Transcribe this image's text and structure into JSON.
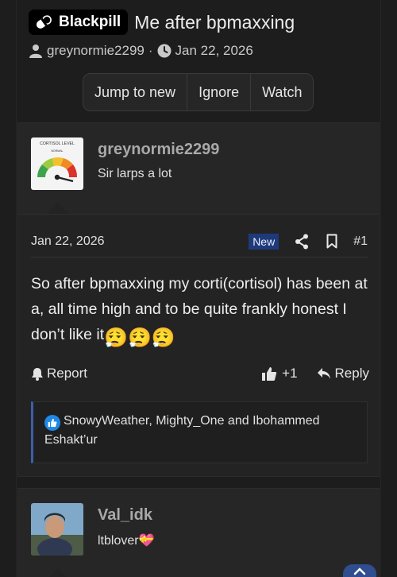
{
  "thread": {
    "prefix": "Blackpill",
    "title": "Me after bpmaxxing",
    "author": "greynormie2299",
    "separator": "·",
    "date": "Jan 22, 2026"
  },
  "thread_actions": {
    "jump_label": "Jump to new",
    "ignore_label": "Ignore",
    "watch_label": "Watch"
  },
  "avatar1": {
    "caption": "CORTISOL LEVEL",
    "gauge_label": "NORMAL"
  },
  "post": {
    "username": "greynormie2299",
    "user_title": "Sir larps a lot",
    "date": "Jan 22, 2026",
    "new_badge": "New",
    "number": "#1",
    "body": "So after bpmaxxing my corti(cortisol) has been at a, all time high and to be quite frankly honest I don’t like it",
    "emoji": "😮‍💨😮‍💨😮‍💨",
    "report_label": "Report",
    "like_count": "+1",
    "reply_label": "Reply",
    "reactions_text": "SnowyWeather, Mighty_One and Ibohammed Eshakt’ur"
  },
  "post2": {
    "username": "Val_idk",
    "user_title": "ltblover",
    "title_emoji": "💝"
  },
  "colors": {
    "accent": "#1f3a7a",
    "reaction_border": "#3d5fa8",
    "like_blue": "#1e88e5"
  }
}
